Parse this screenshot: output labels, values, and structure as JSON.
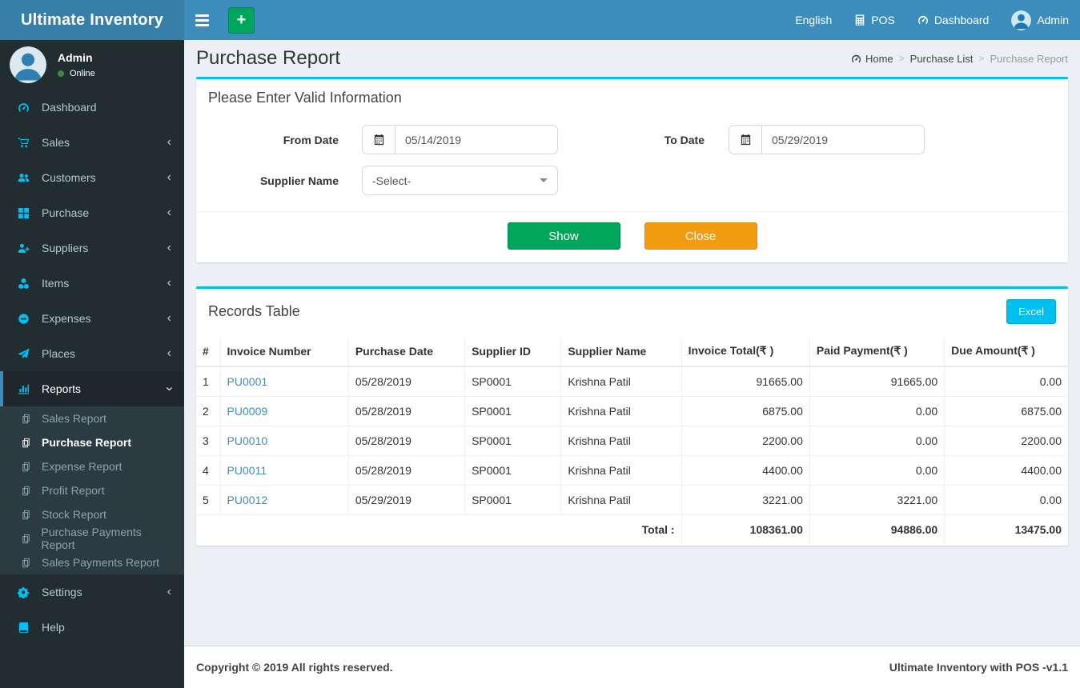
{
  "colors": {
    "navbar": "#3c8dbc",
    "logo_bg": "#367fa9",
    "sidebar_bg": "#222d32",
    "submenu_bg": "#2c3b41",
    "sidebar_icon": "#00c0ef",
    "active_border": "#3c8dbc",
    "card_top_border": "#00c0ef",
    "success": "#00a65a",
    "warning": "#f39c12",
    "info": "#00c0ef",
    "link": "#3c8dbc",
    "online_dot": "#3c8c3c",
    "content_bg": "#ecf0f5"
  },
  "brand": {
    "title": "Ultimate Inventory"
  },
  "navbar": {
    "language": "English",
    "pos_label": "POS",
    "dashboard_label": "Dashboard",
    "user_label": "Admin"
  },
  "sidebar": {
    "user": {
      "name": "Admin",
      "status": "Online"
    },
    "menu": [
      {
        "label": "Dashboard",
        "icon": "speedometer-icon",
        "arrow": ""
      },
      {
        "label": "Sales",
        "icon": "cart-icon",
        "arrow": "left"
      },
      {
        "label": "Customers",
        "icon": "users-icon",
        "arrow": "left"
      },
      {
        "label": "Purchase",
        "icon": "grid-icon",
        "arrow": "left"
      },
      {
        "label": "Suppliers",
        "icon": "user-plus-icon",
        "arrow": "left"
      },
      {
        "label": "Items",
        "icon": "cubes-icon",
        "arrow": "left"
      },
      {
        "label": "Expenses",
        "icon": "minus-circle-icon",
        "arrow": "left"
      },
      {
        "label": "Places",
        "icon": "send-icon",
        "arrow": "left"
      },
      {
        "label": "Reports",
        "icon": "bar-chart-icon",
        "arrow": "down",
        "active": true,
        "submenu": [
          {
            "label": "Sales Report",
            "active": false
          },
          {
            "label": "Purchase Report",
            "active": true
          },
          {
            "label": "Expense Report",
            "active": false
          },
          {
            "label": "Profit Report",
            "active": false
          },
          {
            "label": "Stock Report",
            "active": false
          },
          {
            "label": "Purchase Payments Report",
            "active": false
          },
          {
            "label": "Sales Payments Report",
            "active": false
          }
        ]
      },
      {
        "label": "Settings",
        "icon": "gears-icon",
        "arrow": "left"
      },
      {
        "label": "Help",
        "icon": "book-icon",
        "arrow": ""
      }
    ]
  },
  "page": {
    "title": "Purchase Report",
    "breadcrumb": [
      "Home",
      "Purchase List",
      "Purchase Report"
    ]
  },
  "filter": {
    "title": "Please Enter Valid Information",
    "from_date_label": "From Date",
    "from_date_value": "05/14/2019",
    "to_date_label": "To Date",
    "to_date_value": "05/29/2019",
    "supplier_label": "Supplier Name",
    "supplier_value": "-Select-",
    "show_button": "Show",
    "close_button": "Close"
  },
  "records": {
    "title": "Records Table",
    "excel_button": "Excel",
    "table": {
      "headers": [
        "#",
        "Invoice Number",
        "Purchase Date",
        "Supplier ID",
        "Supplier Name",
        "Invoice Total(₹ )",
        "Paid Payment(₹ )",
        "Due Amount(₹ )"
      ],
      "rows": [
        [
          "1",
          "PU0001",
          "05/28/2019",
          "SP0001",
          "Krishna Patil",
          "91665.00",
          "91665.00",
          "0.00"
        ],
        [
          "2",
          "PU0009",
          "05/28/2019",
          "SP0001",
          "Krishna Patil",
          "6875.00",
          "0.00",
          "6875.00"
        ],
        [
          "3",
          "PU0010",
          "05/28/2019",
          "SP0001",
          "Krishna Patil",
          "2200.00",
          "0.00",
          "2200.00"
        ],
        [
          "4",
          "PU0011",
          "05/28/2019",
          "SP0001",
          "Krishna Patil",
          "4400.00",
          "0.00",
          "4400.00"
        ],
        [
          "5",
          "PU0012",
          "05/29/2019",
          "SP0001",
          "Krishna Patil",
          "3221.00",
          "3221.00",
          "0.00"
        ]
      ],
      "total_label": "Total :",
      "totals": [
        "108361.00",
        "94886.00",
        "13475.00"
      ]
    }
  },
  "footer": {
    "left": "Copyright © 2019 All rights reserved.",
    "right": "Ultimate Inventory with POS -v1.1"
  }
}
